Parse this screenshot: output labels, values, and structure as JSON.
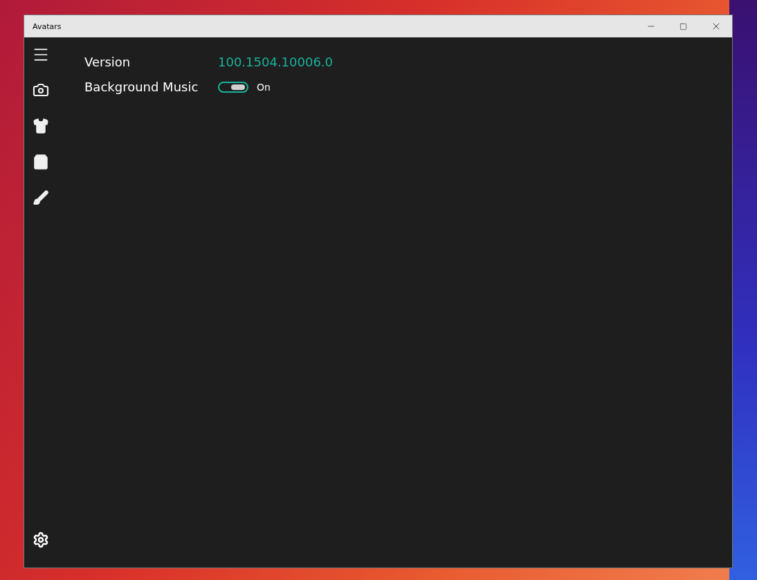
{
  "window": {
    "title": "Avatars"
  },
  "settings": [
    {
      "kind": "text",
      "label": "Version",
      "value": "100.1504.10006.0"
    },
    {
      "kind": "toggle",
      "label": "Background Music",
      "on": true,
      "state_text": "On"
    }
  ]
}
